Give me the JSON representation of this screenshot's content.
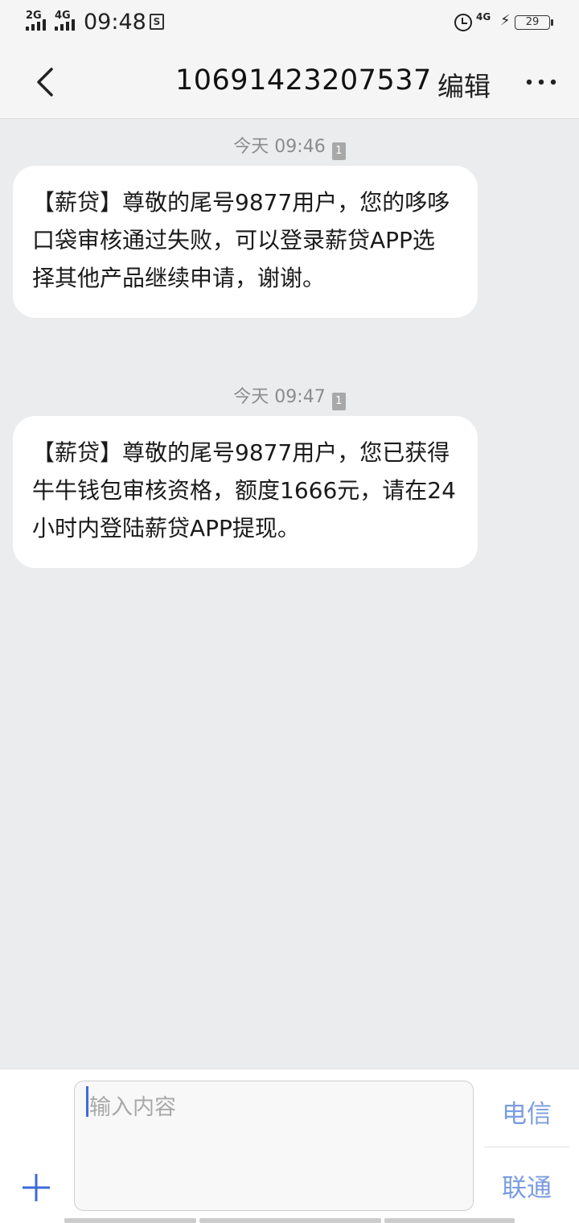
{
  "status_bar": {
    "network_1": "2G",
    "network_2": "4G",
    "time": "09:48",
    "s_icon": "S",
    "network_3": "4G",
    "battery": "29",
    "icons": [
      "signal-icon",
      "alarm-icon",
      "charging-icon",
      "battery-icon"
    ]
  },
  "header": {
    "title": "10691423207537",
    "edit_label": "编辑",
    "icons": [
      "back-chevron-icon",
      "more-dots-icon"
    ]
  },
  "messages": [
    {
      "time": "今天 09:46",
      "sim": "1",
      "text": "【薪贷】尊敬的尾号9877用户，您的哆哆口袋审核通过失败，可以登录薪贷APP选择其他产品继续申请，谢谢。"
    },
    {
      "time": "今天 09:47",
      "sim": "1",
      "text": "【薪贷】尊敬的尾号9877用户，您已获得牛牛钱包审核资格，额度1666元，请在24小时内登陆薪贷APP提现。"
    }
  ],
  "composer": {
    "placeholder": "输入内容",
    "sim1_label": "电信",
    "sim2_label": "联通",
    "icons": [
      "plus-icon"
    ]
  },
  "colors": {
    "background": "#ebeced",
    "bubble": "#ffffff",
    "sim_label": "#7b9de0",
    "plus": "#3d6bd8"
  }
}
